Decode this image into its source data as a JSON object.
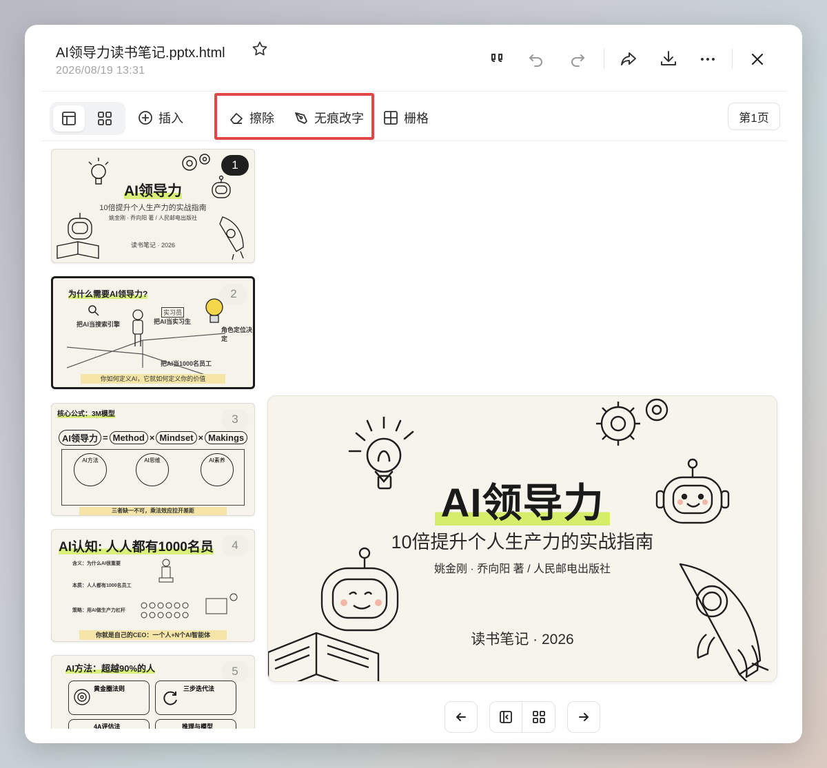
{
  "header": {
    "title": "AI领导力读书笔记.pptx.html",
    "date": "2026/08/19 13:31"
  },
  "toolbar": {
    "insert_label": "插入",
    "erase_label": "擦除",
    "seamless_edit_label": "无痕改字",
    "grid_label": "栅格",
    "page_label": "第1页"
  },
  "thumbnails": [
    {
      "number": "1",
      "title": "AI领导力",
      "subtitle": "10倍提升个人生产力的实战指南",
      "author": "姚金刚 · 乔向阳 著 / 人民邮电出版社",
      "footer": "读书笔记 · 2026"
    },
    {
      "number": "2",
      "title": "为什么需要AI领导力?",
      "labels": [
        "实习员",
        "把AI当搜索引擎",
        "把AI当实习生",
        "角色定位决定",
        "把AI当1000名员工"
      ],
      "footer": "你如何定义AI，它就如何定义你的价值"
    },
    {
      "number": "3",
      "title": "核心公式：3M模型",
      "formula": [
        "AI领导力",
        "=",
        "Method",
        "×",
        "Mindset",
        "×",
        "Makings"
      ],
      "columns": [
        "AI方法",
        "AI思维",
        "AI素养"
      ],
      "footer": "三者缺一不可，乘法效应拉开差距"
    },
    {
      "number": "4",
      "title": "AI认知: 人人都有1000名员",
      "items": [
        "含义：为什么AI很重要",
        "本质：人人都有1000名员工",
        "策略：用AI做生产力杠杆"
      ],
      "footer": "你就是自己的CEO：一个人+N个AI智能体"
    },
    {
      "number": "5",
      "title": "AI方法：超越90%的人",
      "cards": [
        "黄金圈法则",
        "三步迭代法",
        "4A评估法",
        "推理与模型"
      ]
    }
  ],
  "preview": {
    "title": "AI领导力",
    "subtitle": "10倍提升个人生产力的实战指南",
    "author": "姚金刚 · 乔向阳 著 / 人民邮电出版社",
    "footer": "读书笔记 · 2026"
  },
  "icons": [
    "star-icon",
    "quote-icon",
    "undo-icon",
    "redo-icon",
    "share-icon",
    "download-icon",
    "more-icon",
    "close-icon",
    "layout-icon",
    "grid-view-icon",
    "plus-circle-icon",
    "eraser-icon",
    "pen-icon",
    "grid-table-icon",
    "arrow-left-icon",
    "sidebar-icon",
    "arrow-right-icon"
  ],
  "colors": {
    "highlight_box": "#e04848",
    "accent_marker": "#d4ee6c"
  }
}
